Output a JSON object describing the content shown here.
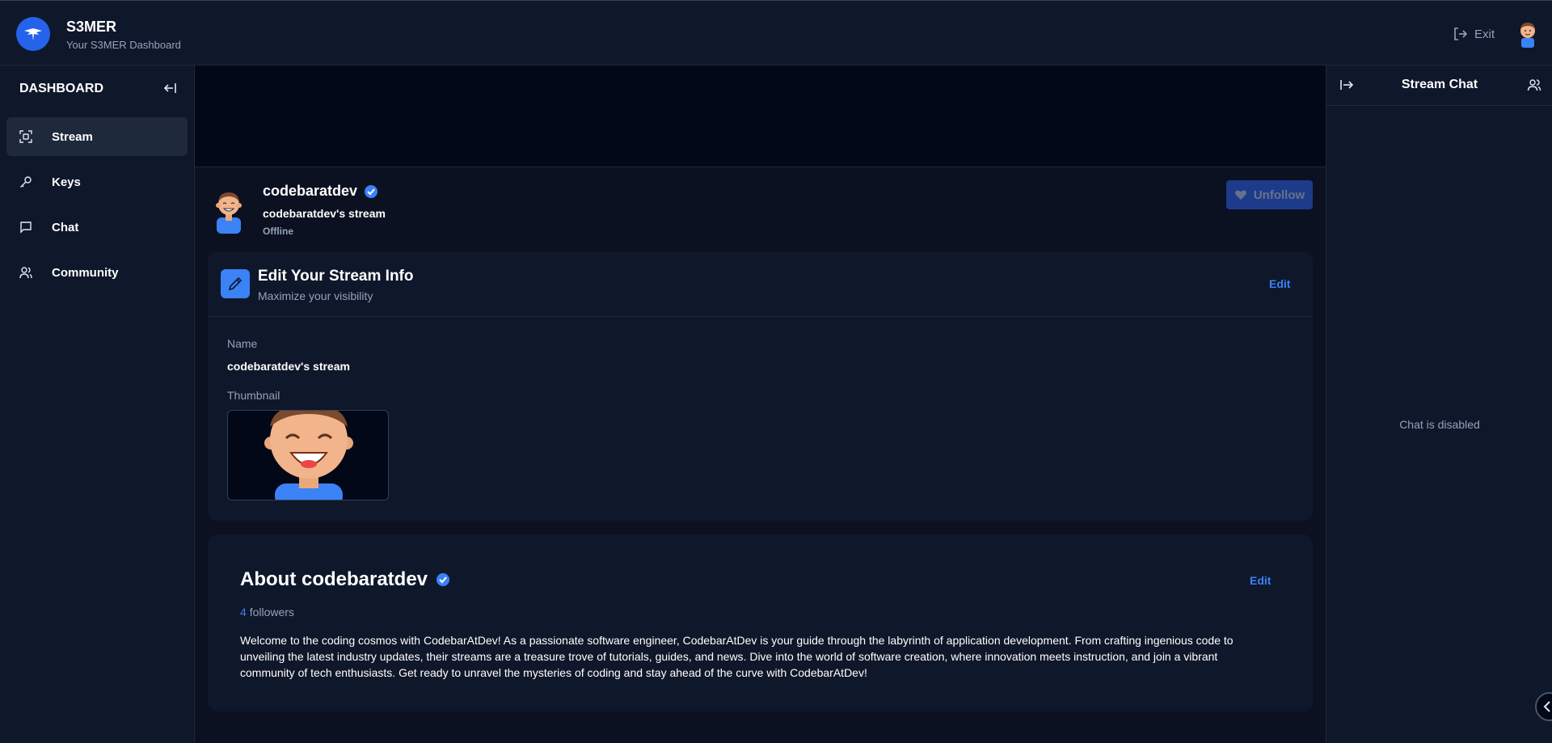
{
  "header": {
    "brand_title": "S3MER",
    "brand_subtitle": "Your S3MER Dashboard",
    "exit_label": "Exit",
    "logo_icon": "bird-logo-icon",
    "accent_color": "#2563eb"
  },
  "sidebar": {
    "title": "DASHBOARD",
    "items": [
      {
        "label": "Stream",
        "icon": "stream-icon",
        "active": true
      },
      {
        "label": "Keys",
        "icon": "key-icon",
        "active": false
      },
      {
        "label": "Chat",
        "icon": "message-icon",
        "active": false
      },
      {
        "label": "Community",
        "icon": "users-icon",
        "active": false
      }
    ]
  },
  "stream": {
    "host_name": "codebaratdev",
    "stream_name": "codebaratdev's stream",
    "status": "Offline",
    "unfollow_label": "Unfollow"
  },
  "edit_card": {
    "title": "Edit Your Stream Info",
    "subtitle": "Maximize your visibility",
    "edit_label": "Edit",
    "name_label": "Name",
    "name_value": "codebaratdev's stream",
    "thumbnail_label": "Thumbnail"
  },
  "about": {
    "title": "About codebaratdev",
    "edit_label": "Edit",
    "followers_count": "4",
    "followers_label": "followers",
    "bio": "Welcome to the coding cosmos with CodebarAtDev! As a passionate software engineer, CodebarAtDev is your guide through the labyrinth of application development. From crafting ingenious code to unveiling the latest industry updates, their streams are a treasure trove of tutorials, guides, and news. Dive into the world of software creation, where innovation meets instruction, and join a vibrant community of tech enthusiasts. Get ready to unravel the mysteries of coding and stay ahead of the curve with CodebarAtDev!"
  },
  "chat": {
    "title": "Stream Chat",
    "disabled_text": "Chat is disabled"
  }
}
